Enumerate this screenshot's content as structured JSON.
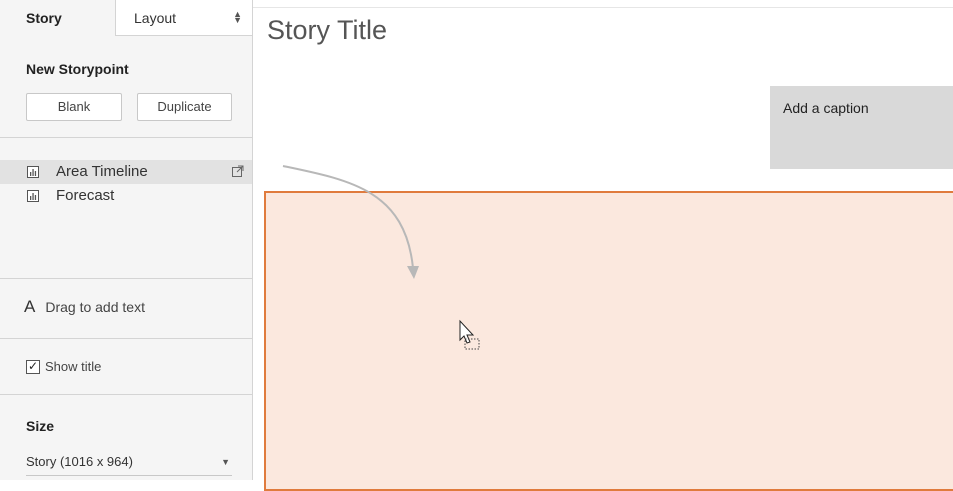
{
  "tabs": {
    "story_label": "Story",
    "layout_label": "Layout"
  },
  "new_storypoint": {
    "title": "New Storypoint",
    "blank_label": "Blank",
    "duplicate_label": "Duplicate"
  },
  "sheets": [
    {
      "label": "Area Timeline",
      "selected": true
    },
    {
      "label": "Forecast",
      "selected": false
    }
  ],
  "drag_text": {
    "letter": "A",
    "label": "Drag to add text"
  },
  "show_title": {
    "label": "Show title",
    "checked": true,
    "mark": "✓"
  },
  "size": {
    "title": "Size",
    "value": "Story (1016 x 964)"
  },
  "story": {
    "title": "Story Title",
    "caption": "Add a caption"
  },
  "colors": {
    "drop_fill": "#fbe8de",
    "drop_border": "#e07b3d",
    "caption_bg": "#d9d9d9"
  }
}
